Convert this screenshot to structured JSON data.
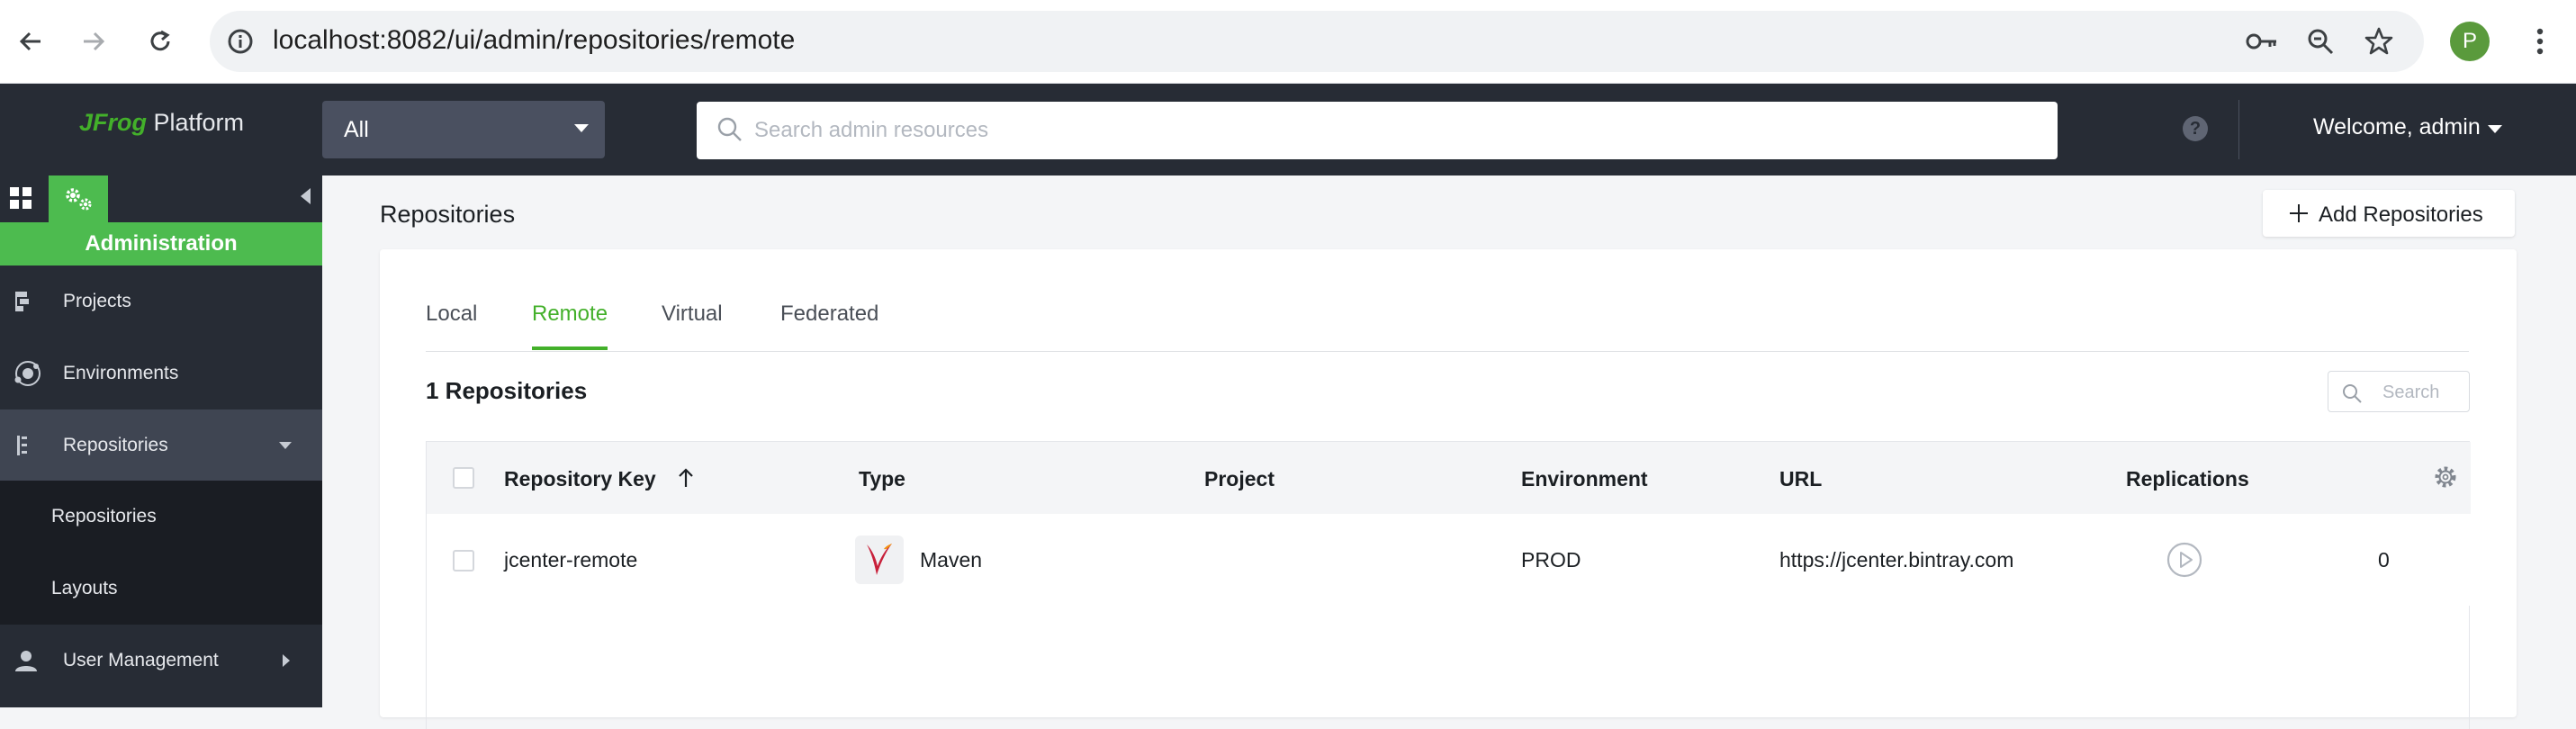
{
  "browser": {
    "url_host": "localhost",
    "url_rest": ":8082/ui/admin/repositories/remote",
    "profile_initial": "P"
  },
  "header": {
    "logo_brand": "JFrog",
    "logo_product": " Platform",
    "scope_value": "All",
    "search_placeholder": "Search admin resources",
    "help_glyph": "?",
    "welcome": "Welcome, admin"
  },
  "sidebar": {
    "section_title": "Administration",
    "items": [
      {
        "label": "Projects",
        "icon": "projects-icon"
      },
      {
        "label": "Environments",
        "icon": "environments-icon"
      },
      {
        "label": "Repositories",
        "icon": "repositories-icon",
        "expanded": true
      },
      {
        "label": "User Management",
        "icon": "user-icon",
        "expanded": false
      }
    ],
    "sub_items": [
      {
        "label": "Repositories"
      },
      {
        "label": "Layouts"
      }
    ]
  },
  "main": {
    "title": "Repositories",
    "add_button": "Add Repositories",
    "tabs": [
      {
        "label": "Local",
        "active": false
      },
      {
        "label": "Remote",
        "active": true
      },
      {
        "label": "Virtual",
        "active": false
      },
      {
        "label": "Federated",
        "active": false
      }
    ],
    "count_text": "1 Repositories",
    "search_placeholder": "Search",
    "columns": [
      "Repository Key",
      "Type",
      "Project",
      "Environment",
      "URL",
      "Replications"
    ],
    "rows": [
      {
        "key": "jcenter-remote",
        "type": "Maven",
        "project": "",
        "environment": "PROD",
        "url": "https://jcenter.bintray.com",
        "replications": "0"
      }
    ]
  },
  "colors": {
    "accent": "#43b02a",
    "header_bg": "#272c35",
    "sidebar_active": "#3f4552"
  }
}
